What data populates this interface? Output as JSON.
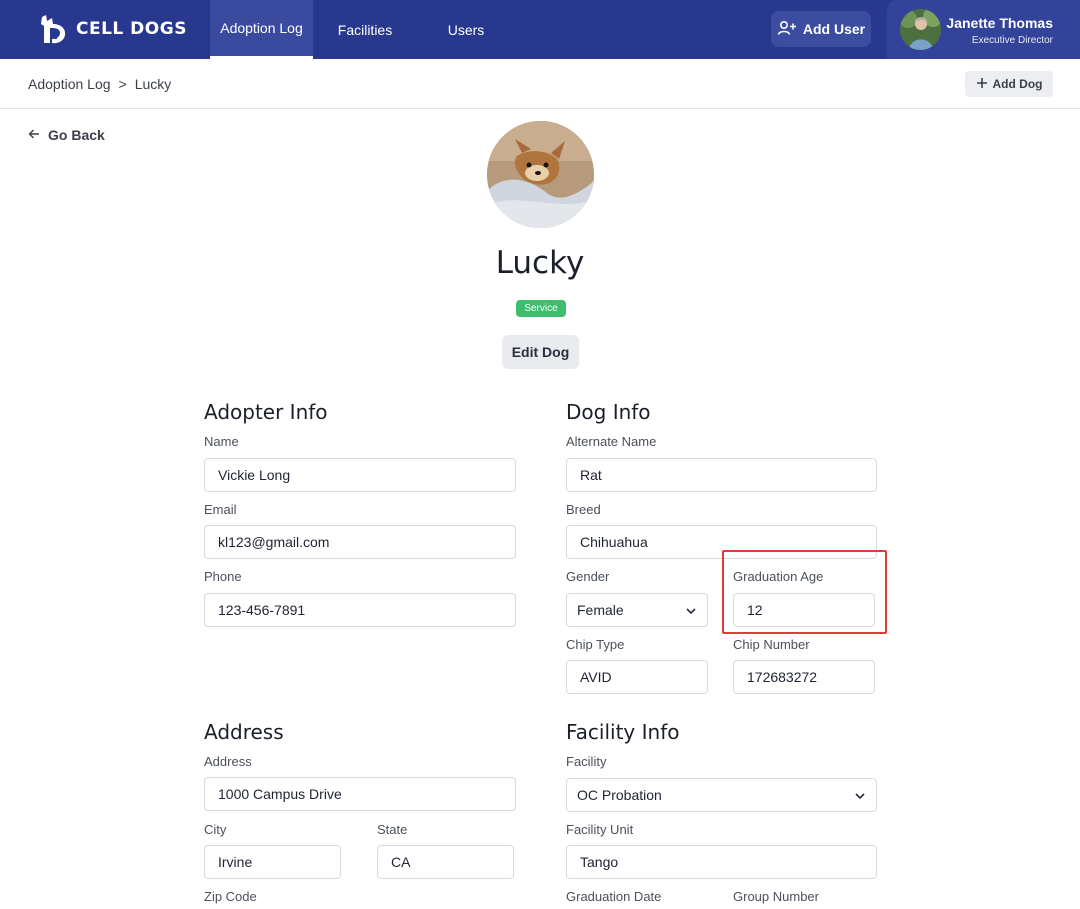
{
  "nav": {
    "logo_text": "CELL DOGS",
    "tabs": [
      {
        "label": "Adoption Log",
        "active": true
      },
      {
        "label": "Facilities",
        "active": false
      },
      {
        "label": "Users",
        "active": false
      }
    ],
    "add_user_label": "Add User",
    "user_name": "Janette Thomas",
    "user_role": "Executive Director",
    "colors": {
      "nav_bg": "#28388f",
      "badge_green": "#3ebd6e",
      "highlight_red": "#e03a3a"
    }
  },
  "breadcrumb": {
    "root": "Adoption Log",
    "separator": ">",
    "current": "Lucky"
  },
  "add_dog_label": "Add Dog",
  "go_back_label": "Go Back",
  "dog": {
    "name": "Lucky",
    "badge": "Service",
    "edit_label": "Edit Dog"
  },
  "adopter": {
    "title": "Adopter Info",
    "name_label": "Name",
    "name_value": "Vickie Long",
    "email_label": "Email",
    "email_value": "kl123@gmail.com",
    "phone_label": "Phone",
    "phone_value": "123-456-7891"
  },
  "dog_info": {
    "title": "Dog Info",
    "alt_name_label": "Alternate Name",
    "alt_name_value": "Rat",
    "breed_label": "Breed",
    "breed_value": "Chihuahua",
    "gender_label": "Gender",
    "gender_value": "Female",
    "grad_age_label": "Graduation Age",
    "grad_age_value": "12",
    "chip_type_label": "Chip Type",
    "chip_type_value": "AVID",
    "chip_number_label": "Chip Number",
    "chip_number_value": "172683272"
  },
  "address": {
    "title": "Address",
    "address_label": "Address",
    "address_value": "1000 Campus Drive",
    "city_label": "City",
    "city_value": "Irvine",
    "state_label": "State",
    "state_value": "CA",
    "zip_label": "Zip Code"
  },
  "facility": {
    "title": "Facility Info",
    "facility_label": "Facility",
    "facility_value": "OC Probation",
    "unit_label": "Facility Unit",
    "unit_value": "Tango",
    "grad_date_label": "Graduation Date",
    "group_number_label": "Group Number"
  },
  "icons": [
    "cell-dogs-logo-icon",
    "add-user-icon",
    "plus-icon",
    "arrow-left-icon",
    "chevron-down-icon"
  ]
}
